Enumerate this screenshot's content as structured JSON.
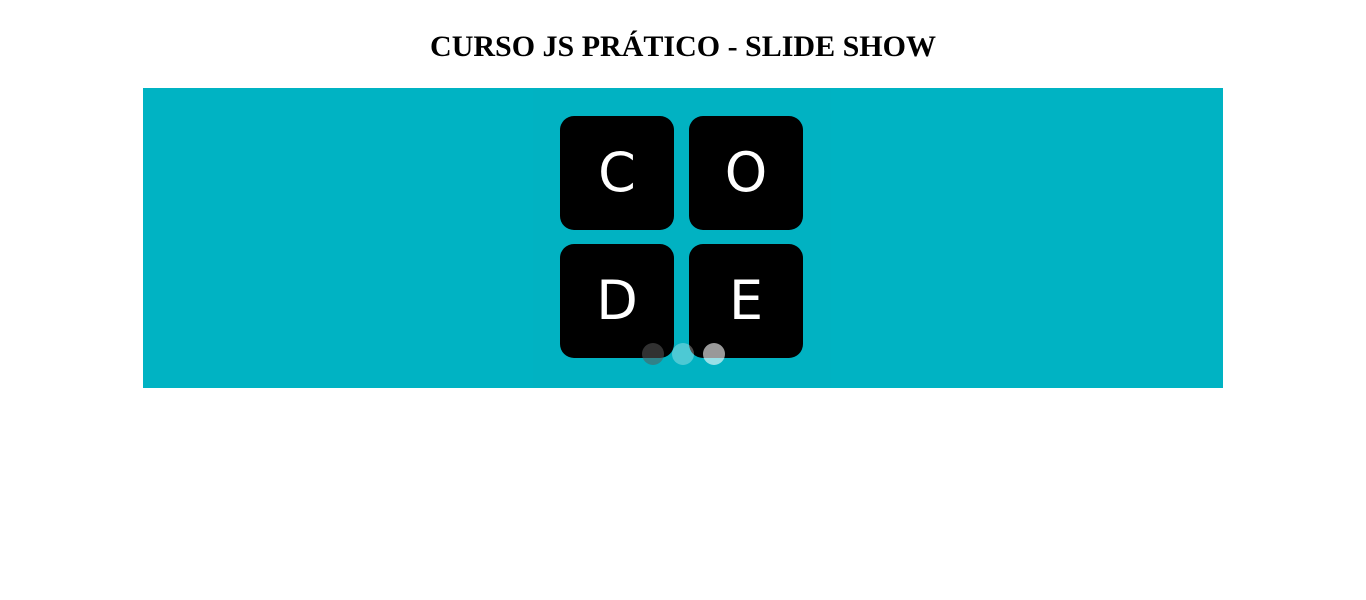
{
  "page": {
    "title": "CURSO JS PRÁTICO - SLIDE SHOW"
  },
  "slideshow": {
    "background_color": "#00b3c3",
    "current_slide": {
      "logo_letters": [
        "C",
        "O",
        "D",
        "E"
      ]
    },
    "dots": [
      {
        "label": "slide 1",
        "state": "active"
      },
      {
        "label": "slide 2",
        "state": "inactive"
      },
      {
        "label": "slide 3",
        "state": "inactive"
      }
    ]
  }
}
